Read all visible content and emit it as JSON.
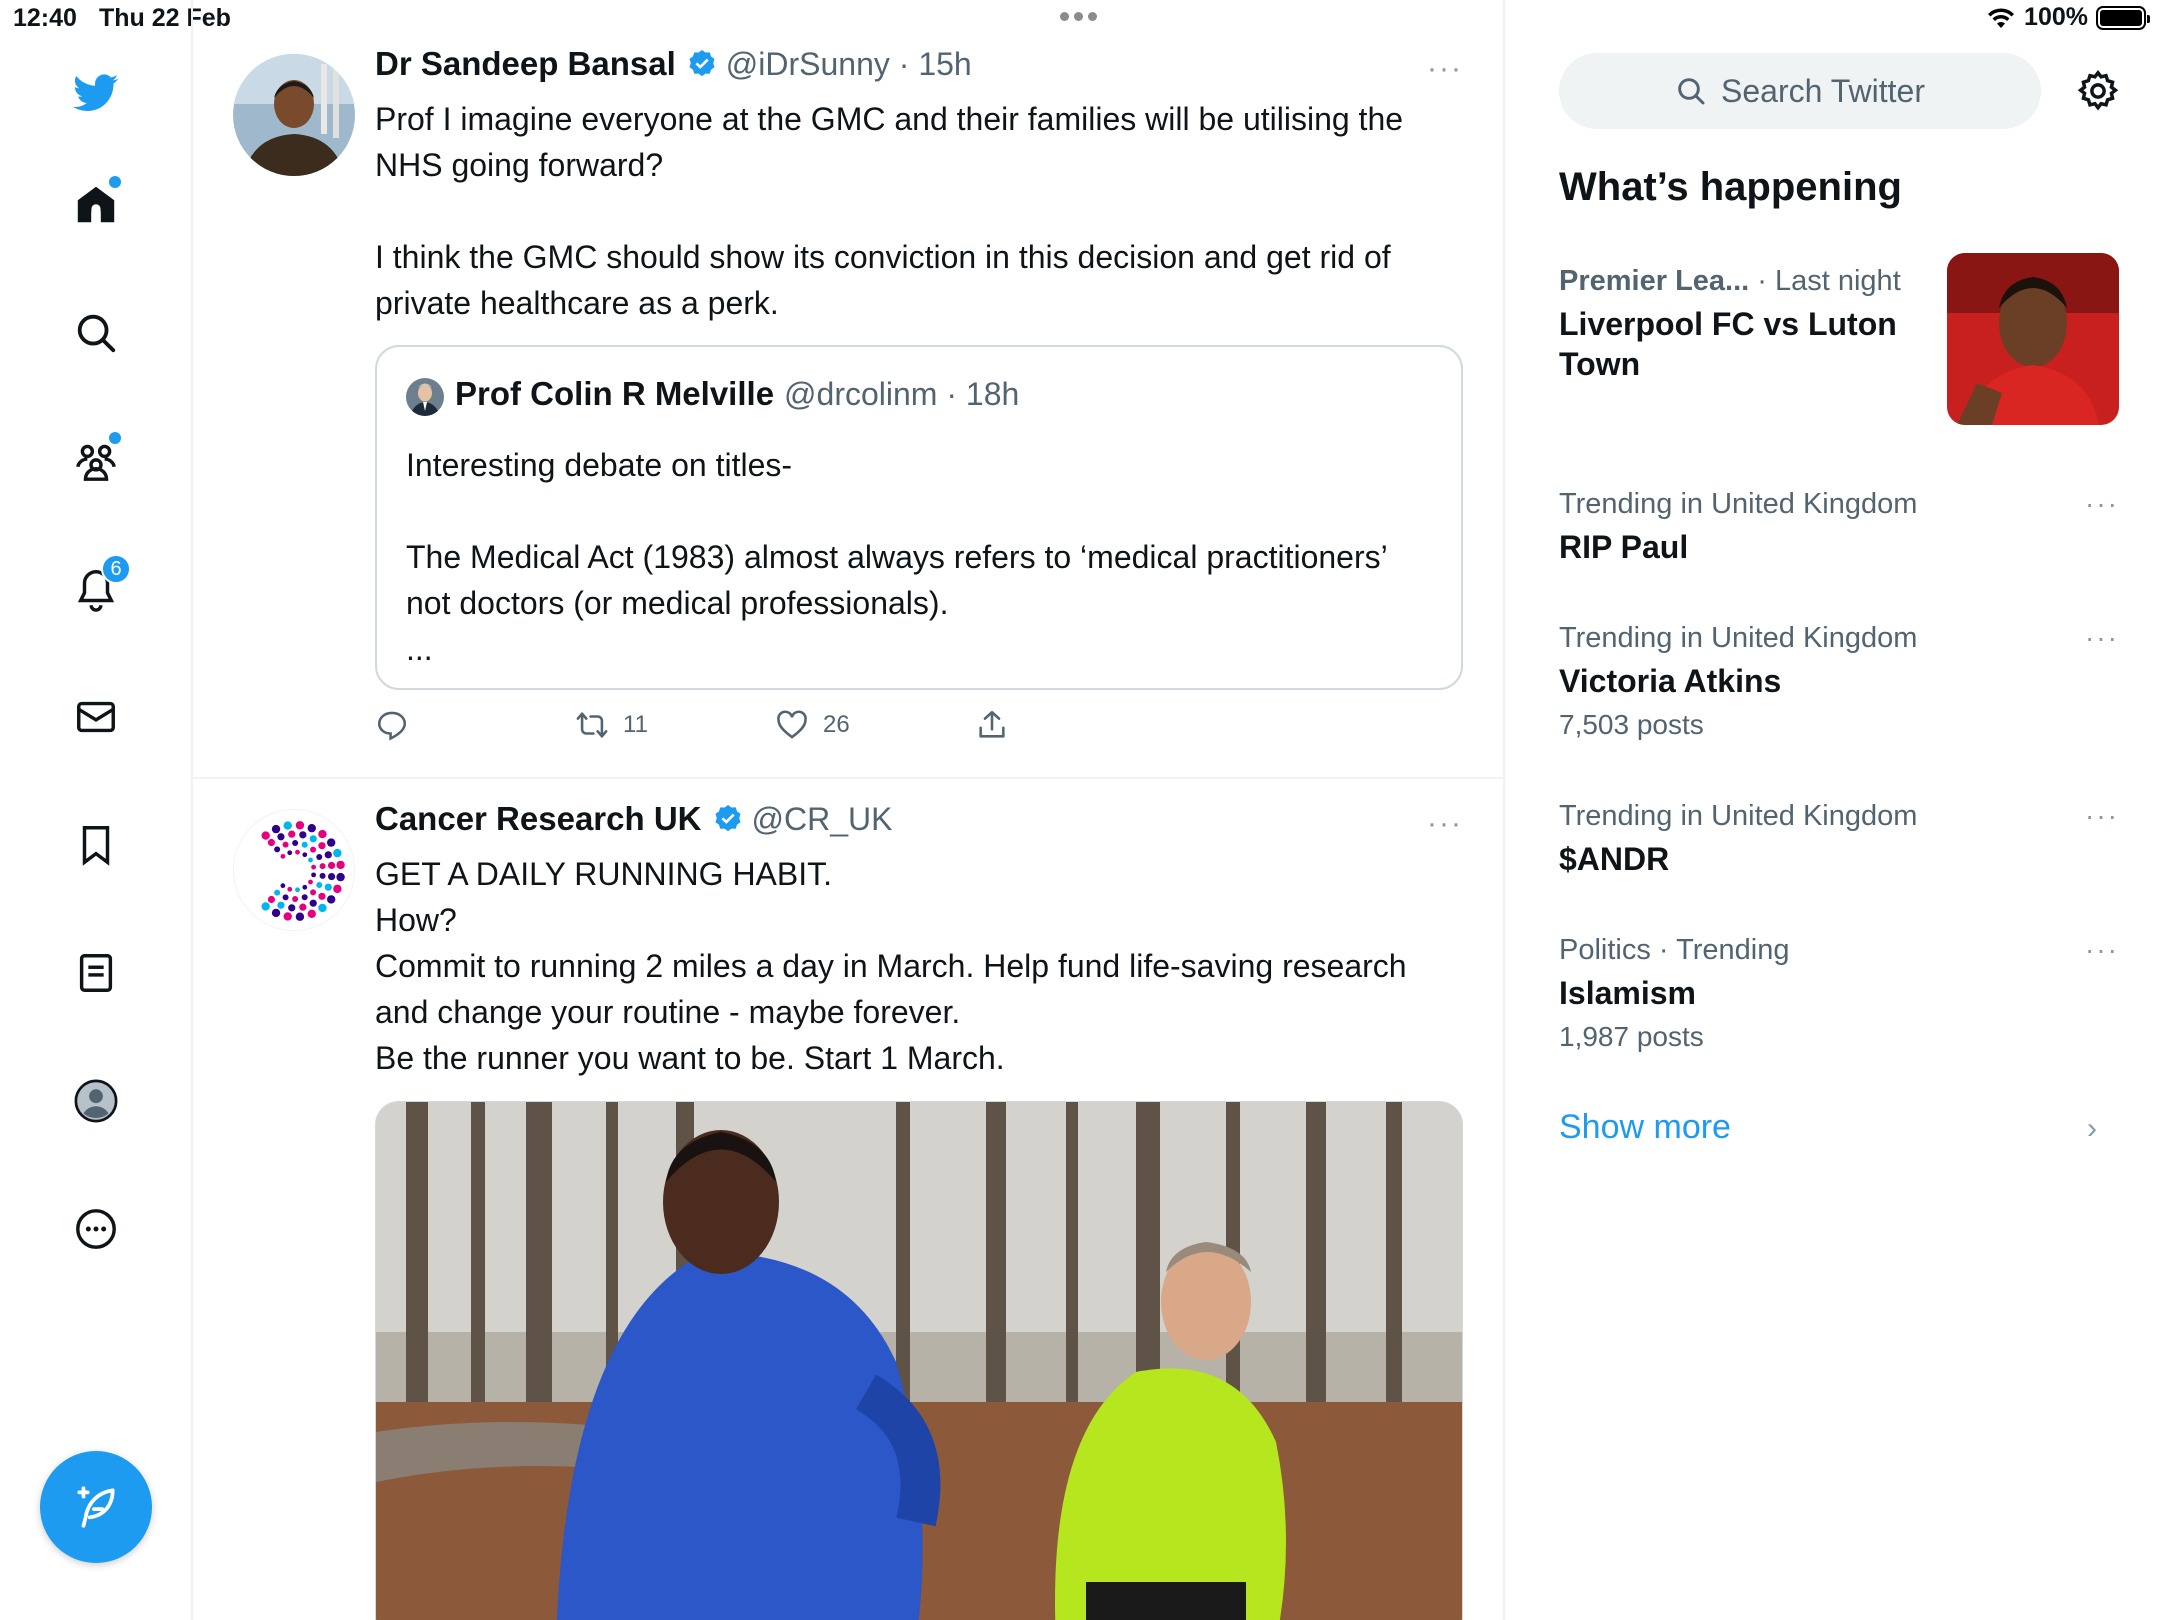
{
  "status_bar": {
    "time": "12:40",
    "date": "Thu 22 Feb",
    "battery": "100%",
    "battery_level": 1.0
  },
  "nav": {
    "items": [
      {
        "name": "home",
        "icon": "home-icon",
        "has_dot": true
      },
      {
        "name": "explore",
        "icon": "search-icon"
      },
      {
        "name": "communities",
        "icon": "communities-icon",
        "has_dot": true
      },
      {
        "name": "notifications",
        "icon": "bell-icon",
        "badge": "6"
      },
      {
        "name": "messages",
        "icon": "mail-icon"
      },
      {
        "name": "bookmarks",
        "icon": "bookmark-icon"
      },
      {
        "name": "lists",
        "icon": "list-icon"
      },
      {
        "name": "profile",
        "icon": "profile-icon"
      },
      {
        "name": "more",
        "icon": "more-circle-icon"
      }
    ],
    "notification_badge": "6",
    "compose_icon": "compose-feather-icon"
  },
  "tweets": [
    {
      "name": "Dr Sandeep Bansal",
      "verified": true,
      "handle_time": "@iDrSunny · 15h",
      "text": "Prof I imagine everyone at the GMC and their families will be utilising the NHS going forward?\n\nI think the GMC should show its conviction in this decision and get rid of private healthcare as a perk.",
      "quote": {
        "name": "Prof Colin R Melville",
        "handle_time": "@drcolinm · 18h",
        "text": "Interesting debate on titles-\n\nThe Medical Act (1983) almost always refers to ‘medical practitioners’ not doctors (or medical professionals).\n..."
      },
      "retweets": "11",
      "likes": "26"
    },
    {
      "name": "Cancer Research UK",
      "verified": true,
      "handle_time": "@CR_UK",
      "text": "GET A DAILY RUNNING HABIT.\nHow?\nCommit to running 2 miles a day in March. Help fund life-saving research and change your routine - maybe forever.\nBe the runner you want to be. Start 1 March."
    }
  ],
  "sidebar": {
    "search_placeholder": "Search Twitter",
    "section_title": "What’s happening",
    "trends": [
      {
        "category": "Premier Lea...",
        "meta_suffix": " · Last night",
        "title": "Liverpool FC vs Luton Town"
      },
      {
        "category": "Trending in United Kingdom",
        "title": "RIP Paul"
      },
      {
        "category": "Trending in United Kingdom",
        "title": "Victoria Atkins",
        "count": "7,503 posts"
      },
      {
        "category": "Trending in United Kingdom",
        "title": "$ANDR"
      },
      {
        "category": "Politics · Trending",
        "title": "Islamism",
        "count": "1,987 posts"
      }
    ],
    "show_more": "Show more",
    "more_label": "···"
  },
  "colors": {
    "accent": "#1d9bf0",
    "text": "#0f1419",
    "muted": "#536471",
    "border": "#eff3f4"
  }
}
